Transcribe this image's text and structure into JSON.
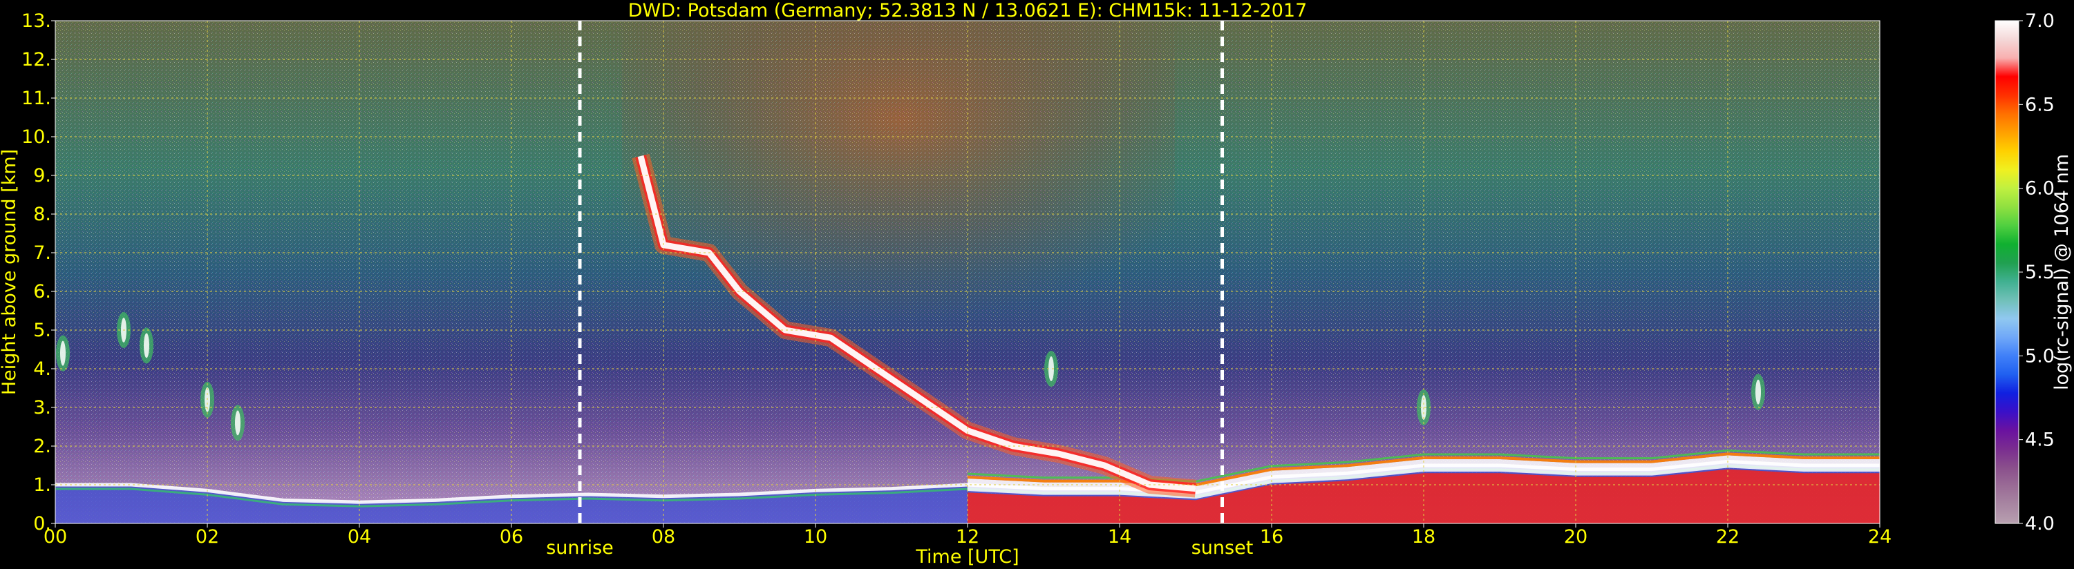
{
  "chart_data": {
    "type": "heatmap",
    "title": "DWD: Potsdam (Germany; 52.3813 N / 13.0621 E):    CHM15k: 11-12-2017",
    "xlabel": "Time [UTC]",
    "ylabel": "Height above ground [km]",
    "xlim": [
      0,
      24
    ],
    "ylim": [
      0,
      13
    ],
    "x_ticks": [
      "00",
      "02",
      "04",
      "06",
      "08",
      "10",
      "12",
      "14",
      "16",
      "18",
      "20",
      "22",
      "24"
    ],
    "y_ticks": [
      "0.",
      "1.",
      "2.",
      "3.",
      "4.",
      "5.",
      "6.",
      "7.",
      "8.",
      "9.",
      "10.",
      "11.",
      "12.",
      "13."
    ],
    "grid": true,
    "events": [
      {
        "label": "sunrise",
        "time": 6.9
      },
      {
        "label": "sunset",
        "time": 15.35
      }
    ],
    "colorbar": {
      "label": "log(rc-signal) @ 1064 nm",
      "range": [
        4.0,
        7.0
      ],
      "ticks": [
        "4.0",
        "4.5",
        "5.0",
        "5.5",
        "6.0",
        "6.5",
        "7.0"
      ],
      "colors": [
        "#b8a0b0",
        "#a886a2",
        "#9a6c96",
        "#8a4f8c",
        "#7a2d90",
        "#6a12a0",
        "#3a10c8",
        "#1020e0",
        "#2060f0",
        "#4080f8",
        "#70a8f8",
        "#90c8f0",
        "#70c0b8",
        "#40b090",
        "#20a050",
        "#10b030",
        "#50d040",
        "#90e040",
        "#c0f040",
        "#f0f020",
        "#ffd000",
        "#ffa000",
        "#ff7000",
        "#ff3000",
        "#ff0000",
        "#f8b0b0",
        "#f4d8d8",
        "#ffffff"
      ]
    },
    "boundary_layer_km": [
      [
        0.0,
        1.0
      ],
      [
        1.0,
        1.0
      ],
      [
        2.0,
        0.85
      ],
      [
        3.0,
        0.6
      ],
      [
        4.0,
        0.55
      ],
      [
        5.0,
        0.6
      ],
      [
        6.0,
        0.7
      ],
      [
        7.0,
        0.75
      ],
      [
        8.0,
        0.7
      ],
      [
        9.0,
        0.75
      ],
      [
        10.0,
        0.85
      ],
      [
        11.0,
        0.9
      ],
      [
        12.0,
        1.0
      ],
      [
        13.0,
        0.9
      ],
      [
        14.0,
        0.9
      ],
      [
        15.0,
        0.8
      ],
      [
        16.0,
        1.2
      ],
      [
        17.0,
        1.3
      ],
      [
        18.0,
        1.5
      ],
      [
        19.0,
        1.5
      ],
      [
        20.0,
        1.4
      ],
      [
        21.0,
        1.4
      ],
      [
        22.0,
        1.6
      ],
      [
        23.0,
        1.5
      ],
      [
        24.0,
        1.5
      ]
    ],
    "cloud_layer_km": [
      [
        7.7,
        9.5
      ],
      [
        8.0,
        7.2
      ],
      [
        8.6,
        7.0
      ],
      [
        9.0,
        6.0
      ],
      [
        9.6,
        5.0
      ],
      [
        10.2,
        4.8
      ],
      [
        10.8,
        4.0
      ],
      [
        11.4,
        3.2
      ],
      [
        12.0,
        2.4
      ],
      [
        12.6,
        2.0
      ],
      [
        13.2,
        1.8
      ],
      [
        13.8,
        1.5
      ],
      [
        14.4,
        1.0
      ],
      [
        15.0,
        0.9
      ]
    ],
    "upper_features_km": [
      [
        0.1,
        4.4
      ],
      [
        0.9,
        5.0
      ],
      [
        1.2,
        4.6
      ],
      [
        2.0,
        3.2
      ],
      [
        2.4,
        2.6
      ],
      [
        13.1,
        4.0
      ],
      [
        18.0,
        3.0
      ],
      [
        22.4,
        3.4
      ]
    ]
  }
}
